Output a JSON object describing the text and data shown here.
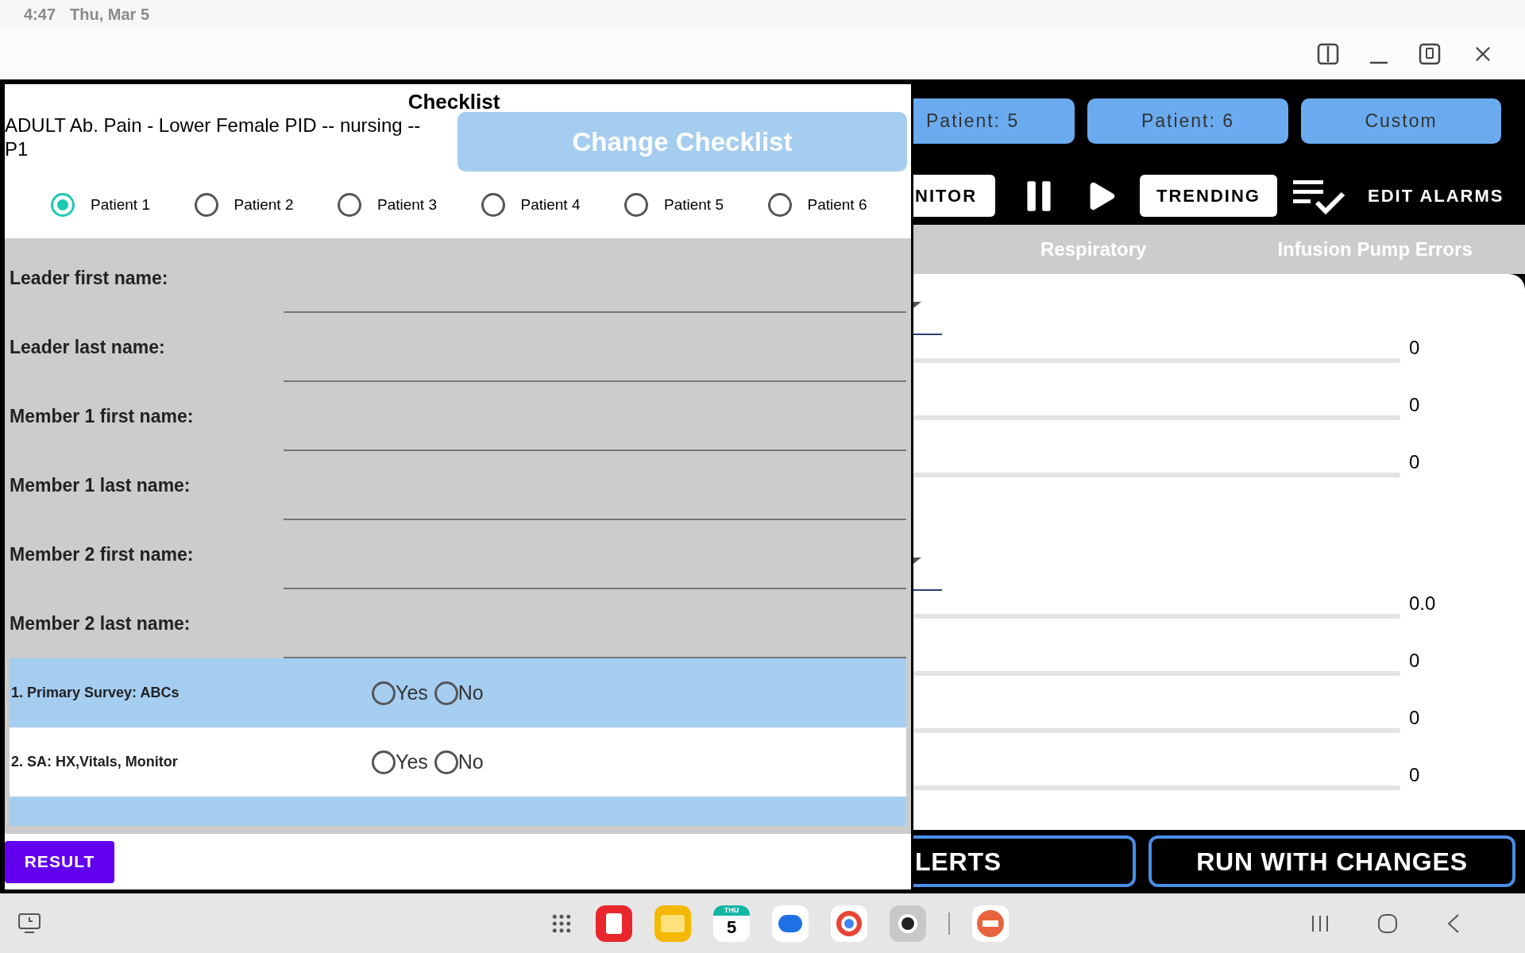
{
  "status_bar": {
    "time": "4:47",
    "date": "Thu, Mar 5"
  },
  "checklist": {
    "title": "Checklist",
    "subtitle": "ADULT Ab. Pain - Lower Female PID -- nursing -- P1",
    "change_button": "Change Checklist",
    "patients": [
      {
        "label": "Patient 1",
        "selected": true
      },
      {
        "label": "Patient 2",
        "selected": false
      },
      {
        "label": "Patient 3",
        "selected": false
      },
      {
        "label": "Patient 4",
        "selected": false
      },
      {
        "label": "Patient 5",
        "selected": false
      },
      {
        "label": "Patient 6",
        "selected": false
      }
    ],
    "fields": [
      {
        "label": "Leader first name:"
      },
      {
        "label": "Leader last name:"
      },
      {
        "label": "Member 1 first name:"
      },
      {
        "label": "Member 1 last name:"
      },
      {
        "label": "Member 2 first name:"
      },
      {
        "label": "Member 2 last name:"
      }
    ],
    "items": [
      {
        "label": "1. Primary Survey: ABCs",
        "options": [
          {
            "label": "Yes",
            "selected": false
          },
          {
            "label": "No",
            "selected": false
          }
        ]
      },
      {
        "label": "2. SA: HX,Vitals, Monitor",
        "options": [
          {
            "label": "Yes",
            "selected": false
          },
          {
            "label": "No",
            "selected": false
          }
        ]
      }
    ],
    "result_button": "RESULT"
  },
  "monitor": {
    "patient_buttons": [
      "Patient: 5",
      "Patient: 6",
      "Custom"
    ],
    "toolbar": {
      "monitor_button": "NITOR",
      "trending_button": "TRENDING",
      "edit_alarms": "EDIT ALARMS"
    },
    "tabs": [
      {
        "label": "Respiratory"
      },
      {
        "label": "Infusion Pump Errors"
      }
    ],
    "groups": [
      {
        "values": [
          "0",
          "0",
          "0"
        ]
      },
      {
        "values": [
          "0.0",
          "0",
          "0",
          "0"
        ]
      }
    ],
    "alerts_button": "LERTS",
    "run_button": "RUN WITH CHANGES"
  },
  "taskbar": {
    "calendar": {
      "day": "THU",
      "date": "5"
    }
  }
}
